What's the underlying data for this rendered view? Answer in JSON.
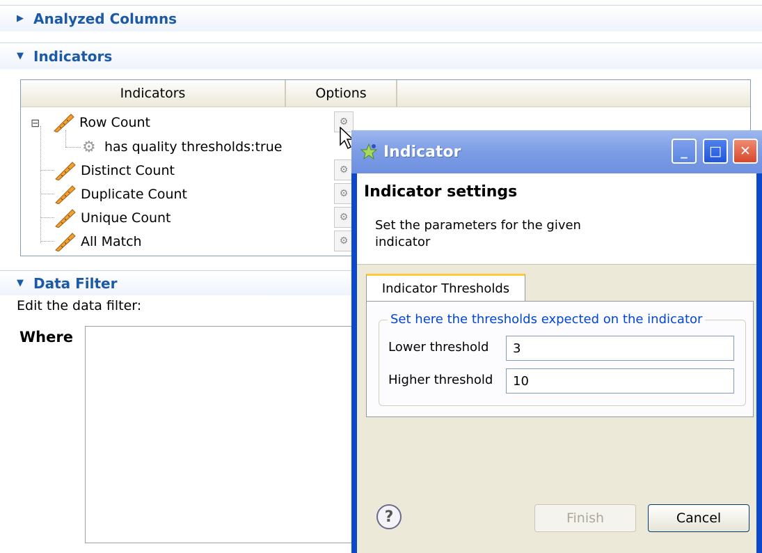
{
  "sections": {
    "analyzed_columns": "Analyzed Columns",
    "indicators": "Indicators",
    "data_filter": "Data Filter"
  },
  "indicators_table": {
    "headers": [
      "Indicators",
      "Options"
    ],
    "rows": [
      {
        "label": "Row Count"
      },
      {
        "label": "has quality thresholds:true"
      },
      {
        "label": "Distinct Count"
      },
      {
        "label": "Duplicate Count"
      },
      {
        "label": "Unique Count"
      },
      {
        "label": "All Match"
      }
    ],
    "collapse_symbol": "⊟"
  },
  "data_filter": {
    "edit_label": "Edit the data filter:",
    "where_label": "Where"
  },
  "dialog": {
    "title": "Indicator",
    "heading": "Indicator settings",
    "description_line1": "Set the parameters for the given",
    "description_line2": "indicator",
    "tab_label": "Indicator Thresholds",
    "group_label": "Set here the thresholds expected on the indicator",
    "lower_label": "Lower threshold",
    "lower_value": "3",
    "higher_label": "Higher threshold",
    "higher_value": "10",
    "help_symbol": "?",
    "finish_label": "Finish",
    "cancel_label": "Cancel",
    "minimize_symbol": "_",
    "maximize_symbol": "□",
    "close_symbol": "✕"
  },
  "colors": {
    "section_title": "#1c5aa8",
    "dialog_frame": "#0a48cc",
    "group_legend": "#0046d5",
    "tab_highlight": "#ffc83c",
    "close_button": "#e0573e"
  },
  "icons": [
    "triangle-right-icon",
    "triangle-down-icon",
    "ruler-icon",
    "gear-icon",
    "indicator-app-icon",
    "help-icon",
    "mouse-cursor-icon"
  ]
}
